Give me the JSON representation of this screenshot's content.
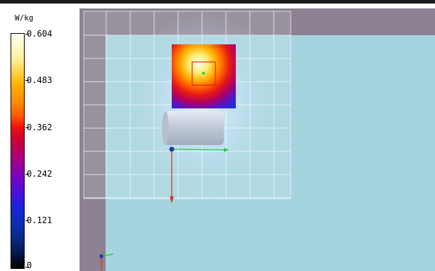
{
  "legend": {
    "unit": "W/kg",
    "ticks": [
      "0.604",
      "0.483",
      "0.362",
      "0.242",
      "0.121",
      "0"
    ]
  },
  "colors": {
    "viewport_bg": "#8c8291",
    "phantom_fill": "#a6d4de",
    "grid_line": "#f2f8fb",
    "axis_x": "#2ecc40",
    "axis_y": "#d03a2a",
    "axis_z": "#1a3aa8"
  },
  "icons": {
    "axes_triad": "xyz-axes-icon",
    "origin_marker": "origin-dot-icon",
    "peak_marker": "peak-location-icon"
  }
}
